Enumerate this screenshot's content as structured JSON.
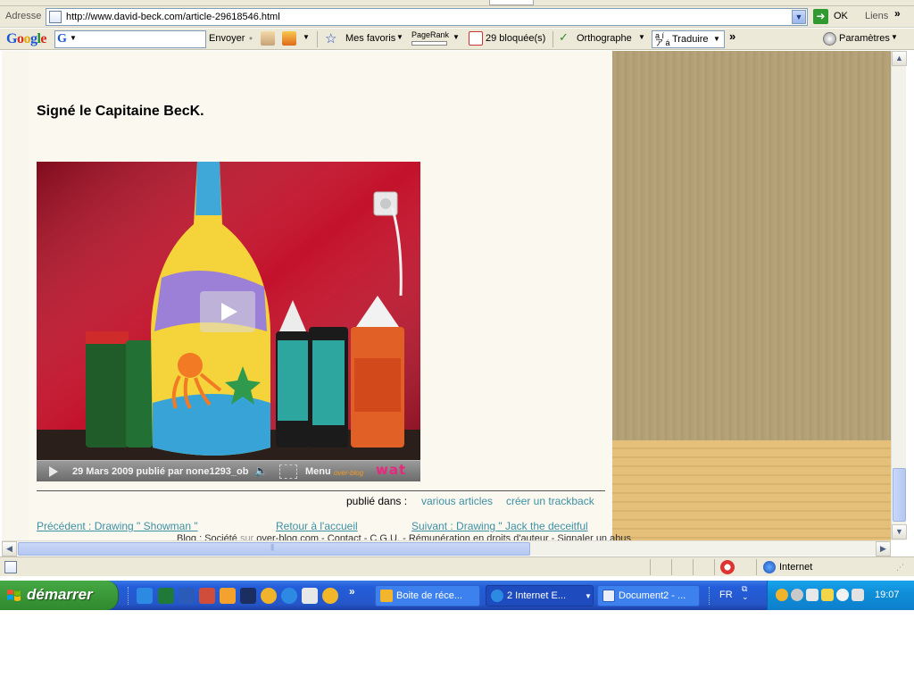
{
  "address_bar": {
    "label": "Adresse",
    "url": "http://www.david-beck.com/article-29618546.html",
    "go_label": "OK",
    "links_label": "Liens",
    "links_chevron": "»"
  },
  "google_toolbar": {
    "logo_letters": [
      "G",
      "o",
      "o",
      "g",
      "l",
      "e"
    ],
    "search_value": "",
    "send_label": "Envoyer",
    "favorites_label": "Mes favoris",
    "pagerank_label": "PageRank",
    "blocked_label": "29 bloquée(s)",
    "spellcheck_label": "Orthographe",
    "translate_label": "Traduire",
    "more_chevron": "»",
    "settings_label": "Paramètres"
  },
  "article": {
    "signature": "Signé le Capitaine BecK.",
    "video": {
      "caption": "29 Mars 2009 publié par none1293_ob",
      "menu_label": "Menu",
      "overblog_label": "over-blog",
      "brand_label": "wat"
    },
    "published_label": "publié dans :",
    "published_links": [
      "various articles",
      "créer un trackback"
    ],
    "nav": {
      "previous": "Précédent : Drawing \" Showman \"",
      "home": "Retour à l'accueil",
      "next": "Suivant : Drawing \" Jack the deceitful"
    },
    "footer": {
      "part1": "Blog : Société",
      "sur": "sur",
      "part2": "over-blog.com - Contact - C.G.U. - Rémunération en droits d'auteur - Signaler un abus"
    }
  },
  "status_bar": {
    "zone_label": "Internet"
  },
  "taskbar": {
    "start_label": "démarrer",
    "quicklaunch_more": "»",
    "tasks": [
      {
        "label": "Boite de réce...",
        "active": false
      },
      {
        "label": "2 Internet E...",
        "active": true
      },
      {
        "label": "Document2 - ...",
        "active": false
      }
    ],
    "language": "FR",
    "clock": "19:07"
  },
  "colors": {
    "link": "#3d90a3",
    "taskbar_blue": "#245edb",
    "start_green": "#3c9b3a",
    "tray_blue": "#0f8fd9",
    "video_background_red": "#c3122b"
  }
}
